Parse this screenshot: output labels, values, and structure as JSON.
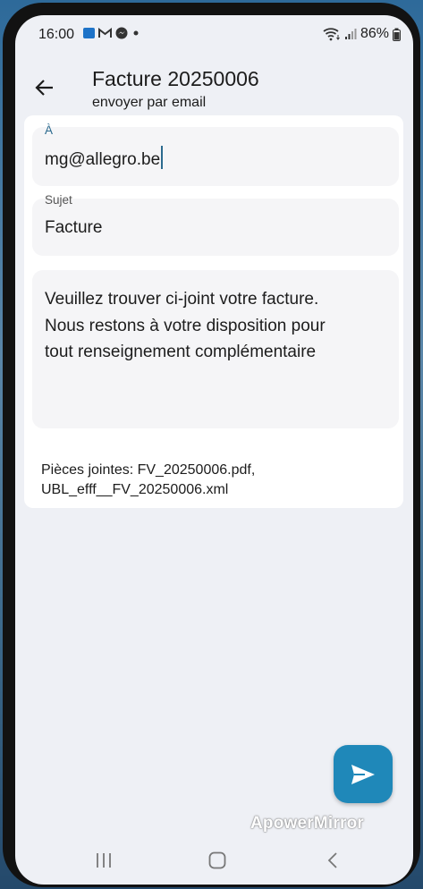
{
  "status_bar": {
    "time": "16:00",
    "battery": "86%"
  },
  "app_bar": {
    "title": "Facture 20250006",
    "subtitle": "envoyer par email"
  },
  "form": {
    "to_label": "À",
    "to_value": "mg@allegro.be",
    "subject_label": "Sujet",
    "subject_value": "Facture",
    "body_lines": [
      "Veuillez trouver ci-joint votre facture.",
      "Nous restons à votre disposition pour",
      "tout renseignement complémentaire"
    ],
    "attachments_line1": "Pièces jointes: FV_20250006.pdf,",
    "attachments_line2": "UBL_efff__FV_20250006.xml"
  },
  "watermark": "ApowerMirror",
  "colors": {
    "accent": "#1f88b9",
    "label_active": "#2b6a8e",
    "background": "#eef0f5"
  }
}
